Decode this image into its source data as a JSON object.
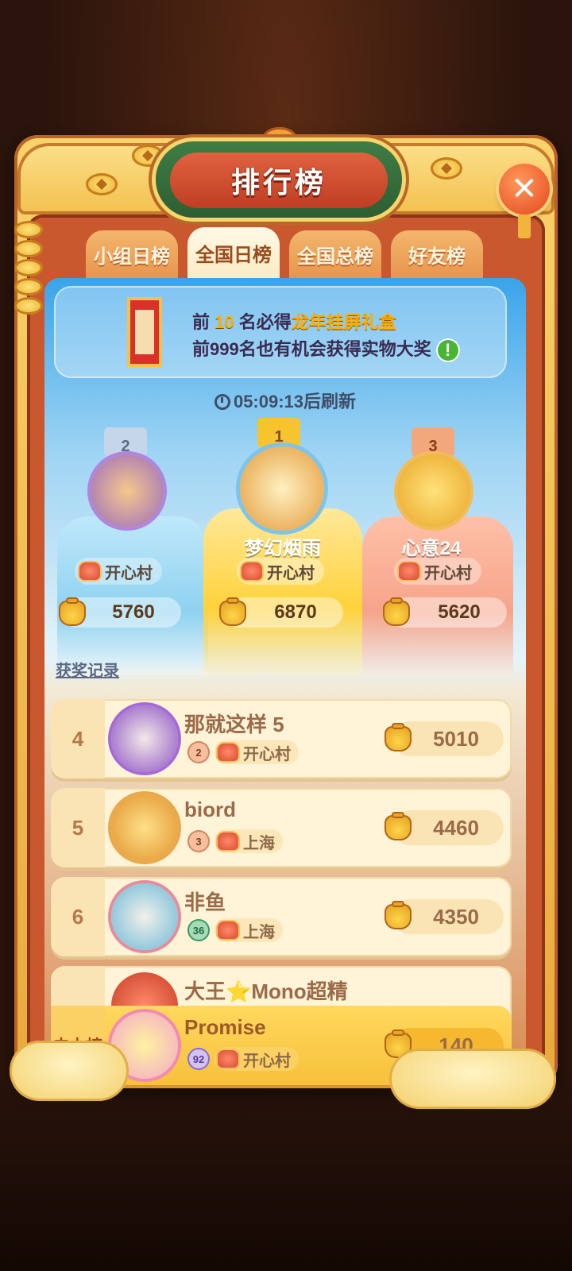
{
  "title": "排行榜",
  "close_label": "✕",
  "tabs": [
    {
      "label": "小组日榜",
      "active": false
    },
    {
      "label": "全国日榜",
      "active": true
    },
    {
      "label": "全国总榜",
      "active": false
    },
    {
      "label": "好友榜",
      "active": false
    }
  ],
  "banner": {
    "line1_prefix": "前",
    "line1_num": "10",
    "line1_mid": "名必得",
    "line1_prize": "龙年挂屏礼盒",
    "line2": "前999名也有机会获得实物大奖",
    "info_icon": "!"
  },
  "refresh_text": "05:09:13后刷新",
  "podium": [
    {
      "rank": "2",
      "name": "",
      "village": "开心村",
      "score": "5760",
      "color": "#8ed4f2"
    },
    {
      "rank": "1",
      "name": "梦幻烟雨",
      "village": "开心村",
      "score": "6870",
      "color": "#ffd23a"
    },
    {
      "rank": "3",
      "name": "心意24",
      "village": "开心村",
      "score": "5620",
      "color": "#f6a48a"
    }
  ],
  "records_link": "获奖记录",
  "rows": [
    {
      "rank": "4",
      "name": "那就这样 5",
      "level": "2",
      "village": "开心村",
      "score": "5010"
    },
    {
      "rank": "5",
      "name": "biord",
      "level": "3",
      "village": "上海",
      "score": "4460"
    },
    {
      "rank": "6",
      "name": "非鱼",
      "level": "36",
      "village": "上海",
      "score": "4350"
    }
  ],
  "partial_row_name": "大王⭐Mono超精",
  "my_row": {
    "rank": "未上榜",
    "name": "Promise",
    "level": "92",
    "village": "开心村",
    "score": "140"
  },
  "accent": "#f7c13a"
}
